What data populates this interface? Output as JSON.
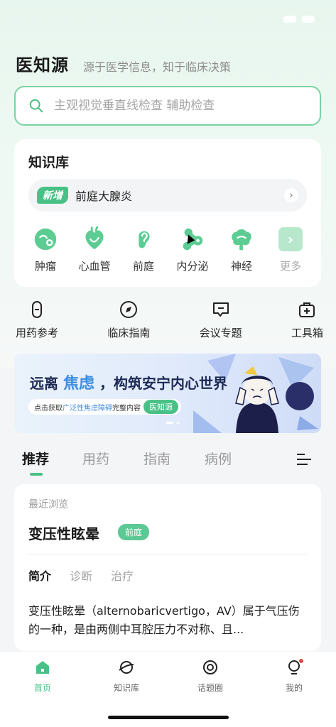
{
  "brand": {
    "name": "医知源",
    "slogan": "源于医学信息，知于临床决策"
  },
  "search": {
    "placeholder": "主观视觉垂直线检查 辅助检查",
    "icon": "search-icon"
  },
  "knowledge_base": {
    "title": "知识库",
    "new_badge": "新增",
    "new_item": "前庭大腺炎",
    "categories": [
      {
        "label": "肿瘤",
        "icon": "tumor-icon"
      },
      {
        "label": "心血管",
        "icon": "heart-icon"
      },
      {
        "label": "前庭",
        "icon": "ear-icon"
      },
      {
        "label": "内分泌",
        "icon": "endocrine-icon"
      },
      {
        "label": "神经",
        "icon": "brain-icon"
      },
      {
        "label": "更多",
        "icon": "chevron-right-icon"
      }
    ]
  },
  "tools": [
    {
      "label": "用药参考",
      "icon": "pill-icon"
    },
    {
      "label": "临床指南",
      "icon": "compass-icon"
    },
    {
      "label": "会议专题",
      "icon": "chat-icon"
    },
    {
      "label": "工具箱",
      "icon": "toolbox-icon"
    }
  ],
  "banner": {
    "title_pre": "远离",
    "title_highlight": "焦虑",
    "title_post": "，构筑安宁内心世界",
    "sub_pre": "点击获取",
    "sub_highlight": "广泛性焦虑障碍",
    "sub_post": "完整内容",
    "pill": "医知源"
  },
  "feed_tabs": [
    "推荐",
    "用药",
    "指南",
    "病例"
  ],
  "recent": {
    "label": "最近浏览",
    "title": "变压性眩晕",
    "badge": "前庭",
    "tabs": [
      "简介",
      "诊断",
      "治疗"
    ],
    "description": "变压性眩晕（alternobaricvertigo，AV）属于气压伤的一种，是由两侧中耳腔压力不对称、且..."
  },
  "bottom_nav": [
    {
      "label": "首页",
      "icon": "home-icon"
    },
    {
      "label": "知识库",
      "icon": "planet-icon"
    },
    {
      "label": "话题圈",
      "icon": "target-icon"
    },
    {
      "label": "我的",
      "icon": "bulb-icon"
    }
  ],
  "colors": {
    "accent": "#49c186",
    "banner_highlight": "#3e8de0"
  }
}
